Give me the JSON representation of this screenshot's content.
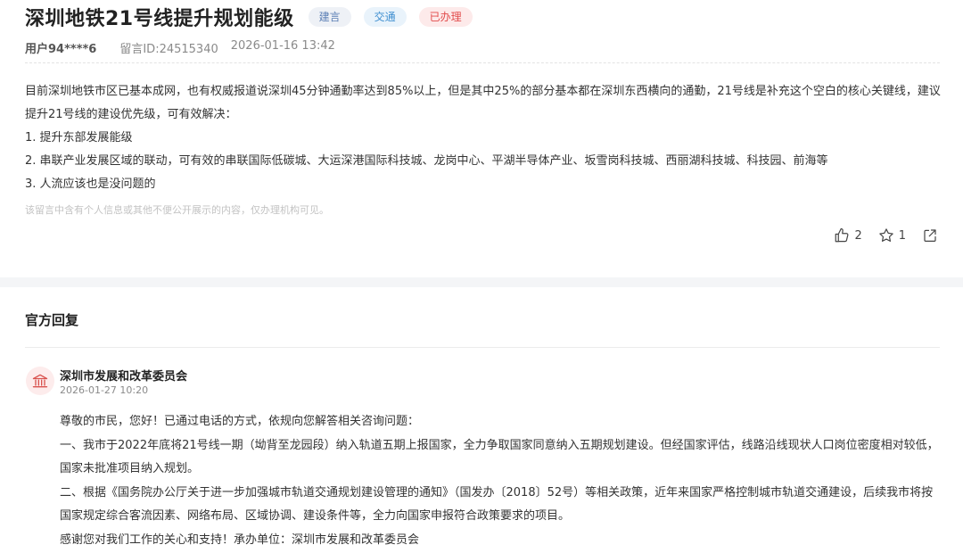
{
  "post": {
    "title": "深圳地铁21号线提升规划能级",
    "tags": [
      "建言",
      "交通",
      "已办理"
    ],
    "user": "用户94****6",
    "message_id": "留言ID:24515340",
    "date": "2026-01-16 13:42",
    "body_lines": [
      "目前深圳地铁市区已基本成网，也有权威报道说深圳45分钟通勤率达到85%以上，但是其中25%的部分基本都在深圳东西横向的通勤，21号线是补充这个空白的核心关键线，建议提升21号线的建设优先级，可有效解决：",
      "1. 提升东部发展能级",
      "2. 串联产业发展区域的联动，可有效的串联国际低碳城、大运深港国际科技城、龙岗中心、平湖半导体产业、坂雪岗科技城、西丽湖科技城、科技园、前海等",
      "3. 人流应该也是没问题的"
    ],
    "privacy_hint": "该留言中含有个人信息或其他不便公开展示的内容，仅办理机构可见。",
    "like_count": "2",
    "favorite_count": "1"
  },
  "reply": {
    "section_title": "官方回复",
    "org_name": "深圳市发展和改革委员会",
    "date": "2026-01-27 10:20",
    "paragraphs": [
      "尊敬的市民，您好！已通过电话的方式，依规向您解答相关咨询问题：",
      "一、我市于2022年底将21号线一期（坳背至龙园段）纳入轨道五期上报国家，全力争取国家同意纳入五期规划建设。但经国家评估，线路沿线现状人口岗位密度相对较低，国家未批准项目纳入规划。",
      "二、根据《国务院办公厅关于进一步加强城市轨道交通规划建设管理的通知》（国发办〔2018〕52号）等相关政策，近年来国家严格控制城市轨道交通建设，后续我市将按国家规定综合客流因素、网络布局、区域协调、建设条件等，全力向国家申报符合政策要求的项目。",
      "感谢您对我们工作的关心和支持！承办单位：深圳市发展和改革委员会"
    ]
  },
  "icons": {
    "like": "thumbs-up-icon",
    "favorite": "star-icon",
    "share": "share-icon",
    "org": "government-building-icon"
  },
  "colors": {
    "tag_suggestion": "#5b7fb5",
    "tag_traffic": "#3f8fd0",
    "tag_done": "#e24b4b",
    "org_icon": "#d9534f"
  }
}
